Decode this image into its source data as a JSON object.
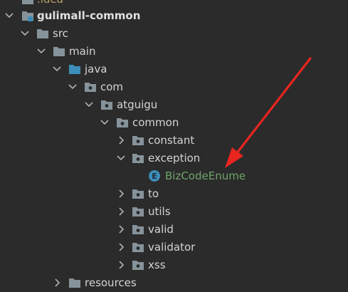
{
  "tree": {
    "idea_label": ".idea",
    "module_label": "gulimall-common",
    "src_label": "src",
    "main_label": "main",
    "java_label": "java",
    "com_label": "com",
    "atguigu_label": "atguigu",
    "common_label": "common",
    "constant_label": "constant",
    "exception_label": "exception",
    "bizcode_label": "BizCodeEnume",
    "bizcode_badge": "E",
    "to_label": "to",
    "utils_label": "utils",
    "valid_label": "valid",
    "validator_label": "validator",
    "xss_label": "xss",
    "resources_label": "resources"
  },
  "colors": {
    "background": "#2b2b2b",
    "folder": "#87939a",
    "source_folder": "#3d8eb9",
    "enum_text": "#6fa56a",
    "arrow": "#e8251f"
  },
  "icons": {
    "folder": "folder-icon",
    "package": "package-icon",
    "module": "module-icon",
    "source_root": "source-root-icon",
    "enum": "enum-icon"
  }
}
